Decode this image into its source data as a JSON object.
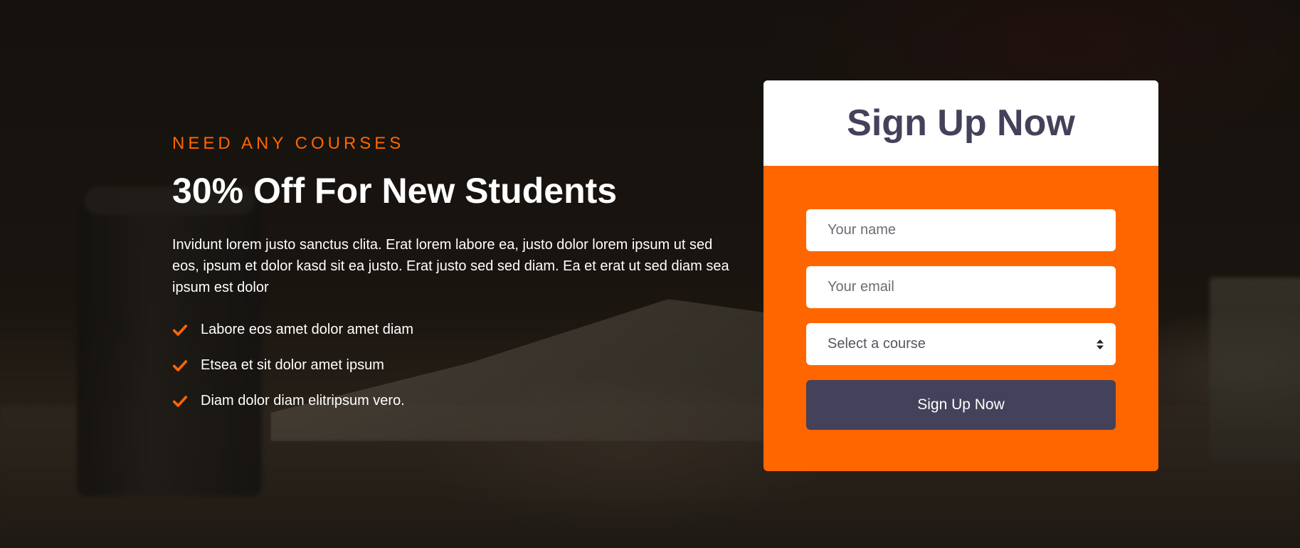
{
  "colors": {
    "accent": "#ff6600",
    "dark": "#43425a",
    "white": "#ffffff"
  },
  "intro": {
    "eyebrow": "NEED ANY COURSES",
    "headline": "30% Off For New Students",
    "description": "Invidunt lorem justo sanctus clita. Erat lorem labore ea, justo dolor lorem ipsum ut sed eos, ipsum et dolor kasd sit ea justo. Erat justo sed sed diam. Ea et erat ut sed diam sea ipsum est dolor",
    "features": [
      {
        "icon": "check-icon",
        "label": "Labore eos amet dolor amet diam"
      },
      {
        "icon": "check-icon",
        "label": "Etsea et sit dolor amet ipsum"
      },
      {
        "icon": "check-icon",
        "label": "Diam dolor diam elitripsum vero."
      }
    ]
  },
  "signup": {
    "title": "Sign Up Now",
    "name_placeholder": "Your name",
    "email_placeholder": "Your email",
    "course_select": {
      "selected": "Select a course",
      "icon": "select-arrows-icon"
    },
    "submit_label": "Sign Up Now"
  }
}
